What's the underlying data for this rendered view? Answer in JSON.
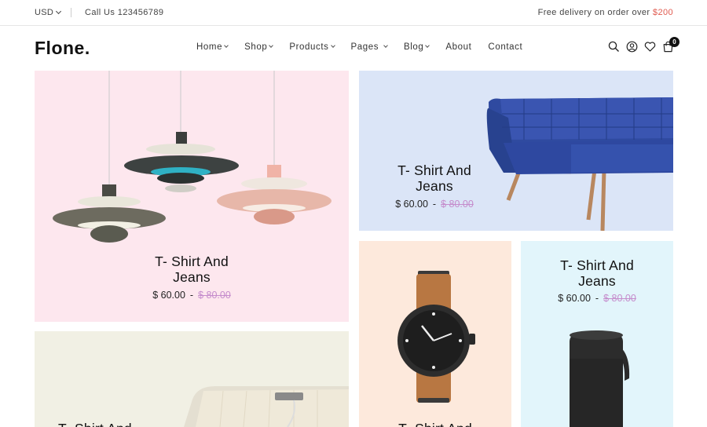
{
  "topbar": {
    "currency": "USD",
    "call": "Call Us 123456789",
    "delivery_text": "Free delivery on order over ",
    "delivery_amount": "$200"
  },
  "header": {
    "logo": "Flone.",
    "nav": [
      {
        "label": "Home",
        "has_caret": true
      },
      {
        "label": "Shop",
        "has_caret": true
      },
      {
        "label": "Products",
        "has_caret": true
      },
      {
        "label": "Pages",
        "has_caret": true
      },
      {
        "label": "Blog",
        "has_caret": true
      },
      {
        "label": "About",
        "has_caret": false
      },
      {
        "label": "Contact",
        "has_caret": false
      }
    ],
    "icons": [
      "search-icon",
      "account-icon",
      "heart-icon",
      "cart-icon"
    ],
    "cart_count": "0"
  },
  "products": [
    {
      "id": "lamps",
      "title_line1": "T- Shirt And",
      "title_line2": "Jeans",
      "price": "$ 60.00",
      "separator": "-",
      "old_price": "$ 80.00",
      "bg": "#fde7ee"
    },
    {
      "id": "sofa",
      "title_line1": "T- Shirt And",
      "title_line2": "Jeans",
      "price": "$ 60.00",
      "separator": "-",
      "old_price": "$ 80.00",
      "bg": "#dbe5f7"
    },
    {
      "id": "watch",
      "title_line1": "T- Shirt And",
      "bg": "#fde9dc"
    },
    {
      "id": "speaker",
      "title_line1": "T- Shirt And",
      "title_line2": "Jeans",
      "price": "$ 60.00",
      "separator": "-",
      "old_price": "$ 80.00",
      "bg": "#e2f5fb"
    },
    {
      "id": "table",
      "title_line1": "T- Shirt And",
      "bg": "#f1f0e4"
    }
  ],
  "colors": {
    "accent": "#e05a4f",
    "old_price": "#c58ccc"
  }
}
